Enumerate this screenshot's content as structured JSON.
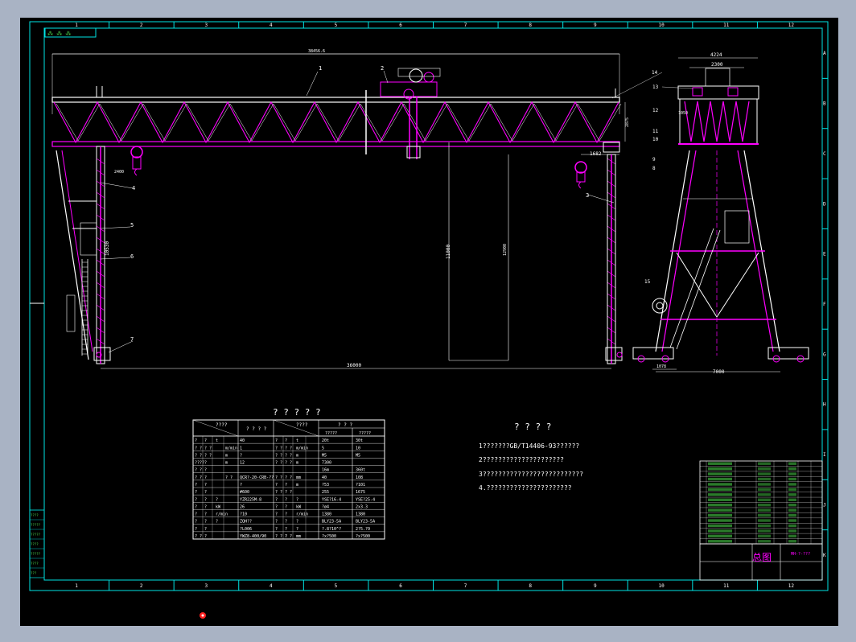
{
  "grid": {
    "cols": [
      "1",
      "2",
      "3",
      "4",
      "5",
      "6",
      "7",
      "8",
      "9",
      "10",
      "11",
      "12"
    ],
    "rows": [
      "A",
      "B",
      "C",
      "D",
      "E",
      "F",
      "G",
      "H",
      "I",
      "J",
      "K"
    ]
  },
  "front_view": {
    "top_dim": "38456.6",
    "span": "36000",
    "height_left": "10530",
    "height_mid": "11000",
    "height_right": "12900",
    "hook_offset": "1682",
    "truss_height": "2875",
    "side_dim": "2400",
    "callouts": [
      "1",
      "2",
      "3",
      "4",
      "5",
      "6",
      "7"
    ]
  },
  "side_view": {
    "top_width": "4224",
    "trolley_width": "2300",
    "base_width": "7000",
    "wheel_dim": "1078",
    "small_dim": "1050",
    "callouts": [
      "14",
      "13",
      "12",
      "11",
      "10",
      "9",
      "8",
      "15"
    ]
  },
  "params_table": {
    "title": "? ? ? ? ?",
    "head_left": "????",
    "head_mid": "? ? ? ?",
    "head_mid2": "????",
    "head_right_top": "? ? ?",
    "head_right_sub": [
      "?????",
      "?????"
    ],
    "rows": [
      [
        "?",
        "?",
        "t",
        "40",
        "?",
        "?",
        "t",
        "20t",
        "30t"
      ],
      [
        "? ? ? ?",
        "m/min",
        "1",
        "? ? ? ?",
        "m/min",
        "5",
        "10"
      ],
      [
        "? ? ? ?",
        "m",
        "?",
        "? ? ? ?",
        "m",
        "M5",
        "M5"
      ],
      [
        "?????",
        "m",
        "12",
        "? ? ? ?",
        "m",
        "7300",
        ""
      ],
      [
        "? ? ?",
        "",
        "",
        "",
        "",
        "16m",
        "360t"
      ],
      [
        "? ? ?",
        "? ?",
        "QCR?-20-CRB-??",
        "? ? ? ?",
        "mm",
        "40",
        "108"
      ],
      [
        "?",
        "?",
        "",
        "?",
        "?",
        "?",
        "m",
        "?53",
        "?101"
      ],
      [
        "?",
        "?",
        "",
        "#600",
        "? ? ? ?",
        "",
        "",
        "255",
        "1675"
      ],
      [
        "?",
        "?",
        "?",
        "YZR225M-8",
        "?",
        "?",
        "?",
        "YSE?16-4",
        "YSE?25-4"
      ],
      [
        "?",
        "?",
        "kW",
        "26",
        "?",
        "?",
        "kW",
        "?ø4",
        "2x3.3"
      ],
      [
        "?",
        "?",
        "r/min",
        "?10",
        "?",
        "?",
        "r/min",
        "1380",
        "1380"
      ],
      [
        "?",
        "?",
        "?",
        "ZQH??",
        "?",
        "?",
        "?",
        "BLY23-5A",
        "BLY23-5A"
      ],
      [
        "?",
        "?",
        "",
        "?L006",
        "?",
        "?",
        "?",
        "?.8?10^?",
        "2?5.?9"
      ],
      [
        "? ? ?",
        "",
        "",
        "YWZ8-400/90",
        "? ? ?",
        "? ?",
        "mm",
        "?x?500",
        "?x?500"
      ]
    ]
  },
  "notes": {
    "title": "? ? ? ?",
    "lines": [
      "1???????GB/T14406-93??????",
      "2?????????????????????",
      "3??????????????????????????",
      "4.??????????????????????"
    ]
  },
  "title_block": {
    "drawing_title": "总图",
    "code": "MH-?-???"
  },
  "left_stamp": [
    "????",
    "?????",
    "?????",
    "????",
    "?????",
    "????",
    "???"
  ],
  "colors": {
    "frame": "#00e5e5",
    "structure": "#ffffff",
    "magenta": "#ff00ff",
    "green": "#4ddf4d",
    "background": "#000000",
    "workspace": "#a9b3c4"
  }
}
